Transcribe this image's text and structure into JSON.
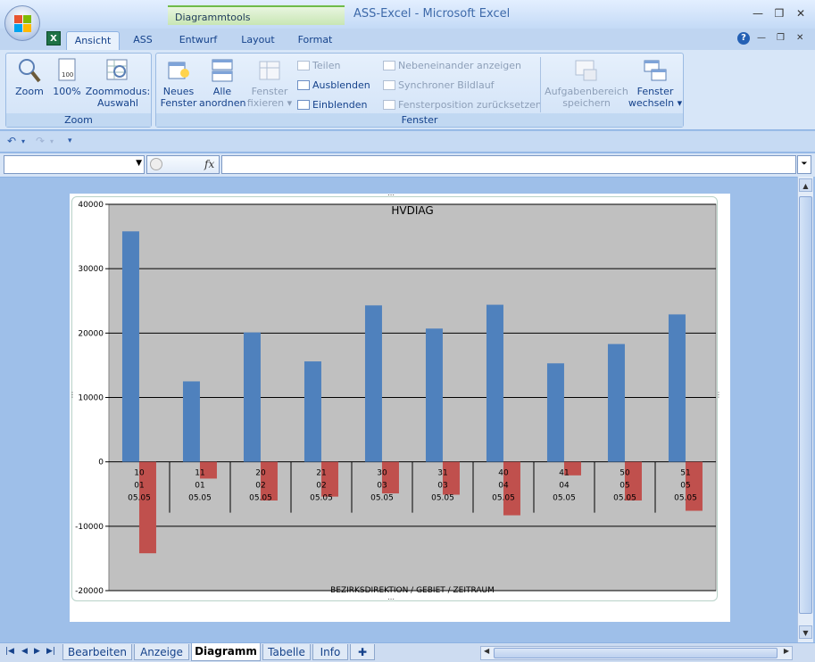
{
  "window": {
    "title": "ASS-Excel  -  Microsoft Excel",
    "context_tab_header": "Diagrammtools",
    "minimize": "—",
    "restore": "❒",
    "close": "✕"
  },
  "tabs": [
    {
      "label": "Ansicht",
      "active": true
    },
    {
      "label": "ASS",
      "active": false
    },
    {
      "label": "Entwurf",
      "active": false
    },
    {
      "label": "Layout",
      "active": false
    },
    {
      "label": "Format",
      "active": false
    }
  ],
  "ribbon": {
    "zoom_group": {
      "label": "Zoom",
      "zoom": "Zoom",
      "hundred": "100%",
      "zoom_selection_1": "Zoommodus:",
      "zoom_selection_2": "Auswahl"
    },
    "window_group": {
      "label": "Fenster",
      "new_window_1": "Neues",
      "new_window_2": "Fenster",
      "arrange_all_1": "Alle",
      "arrange_all_2": "anordnen",
      "freeze_1": "Fenster",
      "freeze_2": "fixieren",
      "split": "Teilen",
      "hide": "Ausblenden",
      "unhide": "Einblenden",
      "side_by_side": "Nebeneinander anzeigen",
      "sync_scroll": "Synchroner Bildlauf",
      "reset_position": "Fensterposition zurücksetzen",
      "save_workspace_1": "Aufgabenbereich",
      "save_workspace_2": "speichern",
      "switch_windows_1": "Fenster",
      "switch_windows_2": "wechseln"
    }
  },
  "formula_bar": {
    "name_box_value": "",
    "fx_label": "fx",
    "formula_value": ""
  },
  "sheet_tabs": [
    {
      "label": "Bearbeiten",
      "active": false
    },
    {
      "label": "Anzeige",
      "active": false
    },
    {
      "label": "Diagramm",
      "active": true
    },
    {
      "label": "Tabelle",
      "active": false
    },
    {
      "label": "Info",
      "active": false
    }
  ],
  "colors": {
    "positive_bar": "#4f81bd",
    "negative_bar": "#c0504d",
    "plot_area": "#c0c0c0"
  },
  "chart_data": {
    "type": "bar",
    "title": "HVDIAG",
    "xlabel": "BEZIRKSDIREKTION / GEBIET / ZEITRAUM",
    "ylabel": "",
    "ylim": [
      -20000,
      40000
    ],
    "yticks": [
      40000,
      30000,
      20000,
      10000,
      0,
      -10000,
      -20000
    ],
    "grid": true,
    "categories": [
      [
        "10",
        "01",
        "05.05"
      ],
      [
        "11",
        "01",
        "05.05"
      ],
      [
        "20",
        "02",
        "05.05"
      ],
      [
        "21",
        "02",
        "05.05"
      ],
      [
        "30",
        "03",
        "05.05"
      ],
      [
        "31",
        "03",
        "05.05"
      ],
      [
        "40",
        "04",
        "05.05"
      ],
      [
        "41",
        "04",
        "05.05"
      ],
      [
        "50",
        "05",
        "05.05"
      ],
      [
        "51",
        "05",
        "05.05"
      ]
    ],
    "series": [
      {
        "values": [
          35800,
          12500,
          20100,
          15600,
          24300,
          20700,
          24400,
          15300,
          18300,
          22900
        ]
      },
      {
        "values": [
          -14200,
          -2600,
          -6000,
          -5400,
          -4900,
          -5100,
          -8300,
          -2100,
          -6000,
          -7600
        ]
      }
    ]
  }
}
